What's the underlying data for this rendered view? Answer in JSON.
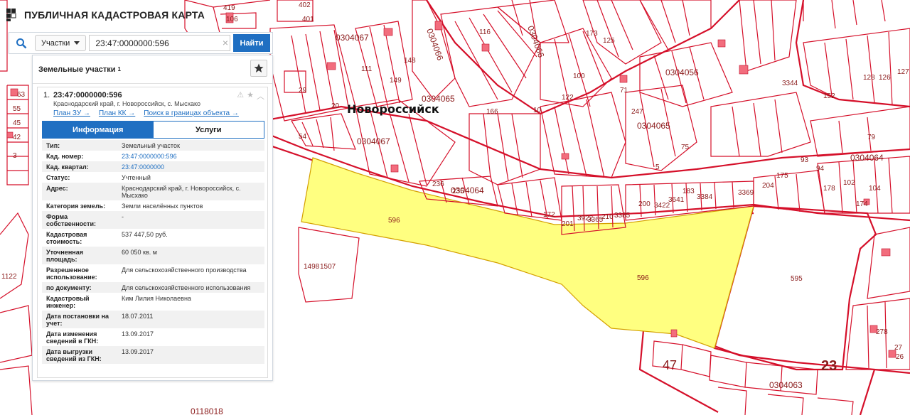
{
  "app": {
    "title": "ПУБЛИЧНАЯ КАДАСТРОВАЯ КАРТА"
  },
  "search": {
    "type_label": "Участки",
    "query": "23:47:0000000:596",
    "find_label": "Найти"
  },
  "panel": {
    "title": "Земельные участки",
    "count": "1",
    "item": {
      "index": "1.",
      "number": "23:47:0000000:596",
      "address": "Краснодарский край, г. Новороссийск, с. Мысхако",
      "links": [
        "План ЗУ →",
        "План КК →",
        "Поиск в границах объекта →"
      ],
      "tabs": [
        "Информация",
        "Услуги"
      ],
      "rows": [
        {
          "k": "Тип:",
          "v": "Земельный участок"
        },
        {
          "k": "Кад. номер:",
          "v": "23:47:0000000:596"
        },
        {
          "k": "Кад. квартал:",
          "v": "23:47:0000000"
        },
        {
          "k": "Статус:",
          "v": "Учтенный"
        },
        {
          "k": "Адрес:",
          "v": "Краснодарский край, г. Новороссийск, с. Мысхако"
        },
        {
          "k": "Категория земель:",
          "v": "Земли населённых пунктов"
        },
        {
          "k": "Форма собственности:",
          "v": "-"
        },
        {
          "k": "Кадастровая стоимость:",
          "v": "537 447,50 руб."
        },
        {
          "k": "Уточненная площадь:",
          "v": "60 050 кв. м"
        },
        {
          "k": "Разрешенное использование:",
          "v": "Для сельскохозяйственного производства"
        },
        {
          "k": "по документу:",
          "v": "Для сельскохозяйственного использования"
        },
        {
          "k": "Кадастровый инженер:",
          "v": "Ким Лилия Николаевна"
        },
        {
          "k": "Дата постановки на учет:",
          "v": "18.07.2011"
        },
        {
          "k": "Дата изменения сведений в ГКН:",
          "v": "13.09.2017"
        },
        {
          "k": "Дата выгрузки сведений из ГКН:",
          "v": "13.09.2017"
        }
      ]
    }
  },
  "map": {
    "city_label": "Новороссийск",
    "highlight_color": "#ffff80",
    "border_color": "#d5102a",
    "quarter_labels": [
      "0304067",
      "0304065",
      "0304066",
      "0304066",
      "0304056",
      "0304065",
      "0304064",
      "0304067",
      "0304064",
      "0304063",
      "0118018"
    ],
    "parcel_labels": [
      "596",
      "596",
      "595",
      "1498",
      "1507",
      "47",
      "23",
      "419",
      "402",
      "401",
      "106",
      "63",
      "55",
      "45",
      "42",
      "3",
      "29",
      "20",
      "54",
      "111",
      "149",
      "148",
      "116",
      "173",
      "125",
      "100",
      "71",
      "10",
      "75",
      "5",
      "236",
      "235",
      "172",
      "201",
      "3922",
      "3365",
      "210",
      "3385",
      "200",
      "3422",
      "3641",
      "183",
      "3384",
      "3369",
      "204",
      "175",
      "94",
      "178",
      "102",
      "104",
      "174",
      "152",
      "3344",
      "126",
      "127",
      "128",
      "1122",
      "278",
      "27",
      "26",
      "93",
      "79",
      "122",
      "166",
      "247"
    ]
  }
}
